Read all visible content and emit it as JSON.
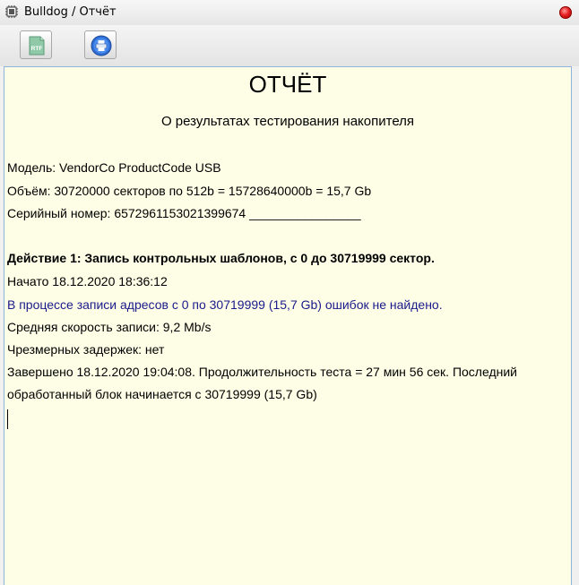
{
  "window": {
    "title": "Bulldog / Отчёт",
    "app_icon": "chip-icon",
    "close_icon": "close-icon"
  },
  "toolbar": {
    "rtf_button_icon": "rtf-file-icon",
    "rtf_button_text": "RTF",
    "print_button_icon": "printer-icon"
  },
  "report": {
    "title": "ОТЧЁТ",
    "subtitle": "О результатах тестирования накопителя",
    "model": "Модель: VendorCo ProductCode USB",
    "volume": "Объём: 30720000 секторов по 512b = 15728640000b = 15,7 Gb",
    "serial": "Серийный номер: 6572961153021399674 ________________",
    "action_header": "Действие 1: Запись контрольных шаблонов, с 0 до 30719999 сектор.",
    "started": "Начато 18.12.2020 18:36:12",
    "result": "В процессе записи адресов с 0 по 30719999 (15,7 Gb) ошибок не найдено.",
    "avg_speed": "Средняя скорость записи:  9,2 Mb/s",
    "delays": "Чрезмерных задержек: нет",
    "finished_line1": "Завершено 18.12.2020 19:04:08. Продолжительность теста = 27 мин 56 сек.  Последний",
    "finished_line2": "обработанный блок начинается с 30719999 (15,7 Gb)"
  },
  "colors": {
    "report_background": "#fefee6",
    "result_text": "#1a1a8c",
    "close_button": "#e52222"
  }
}
